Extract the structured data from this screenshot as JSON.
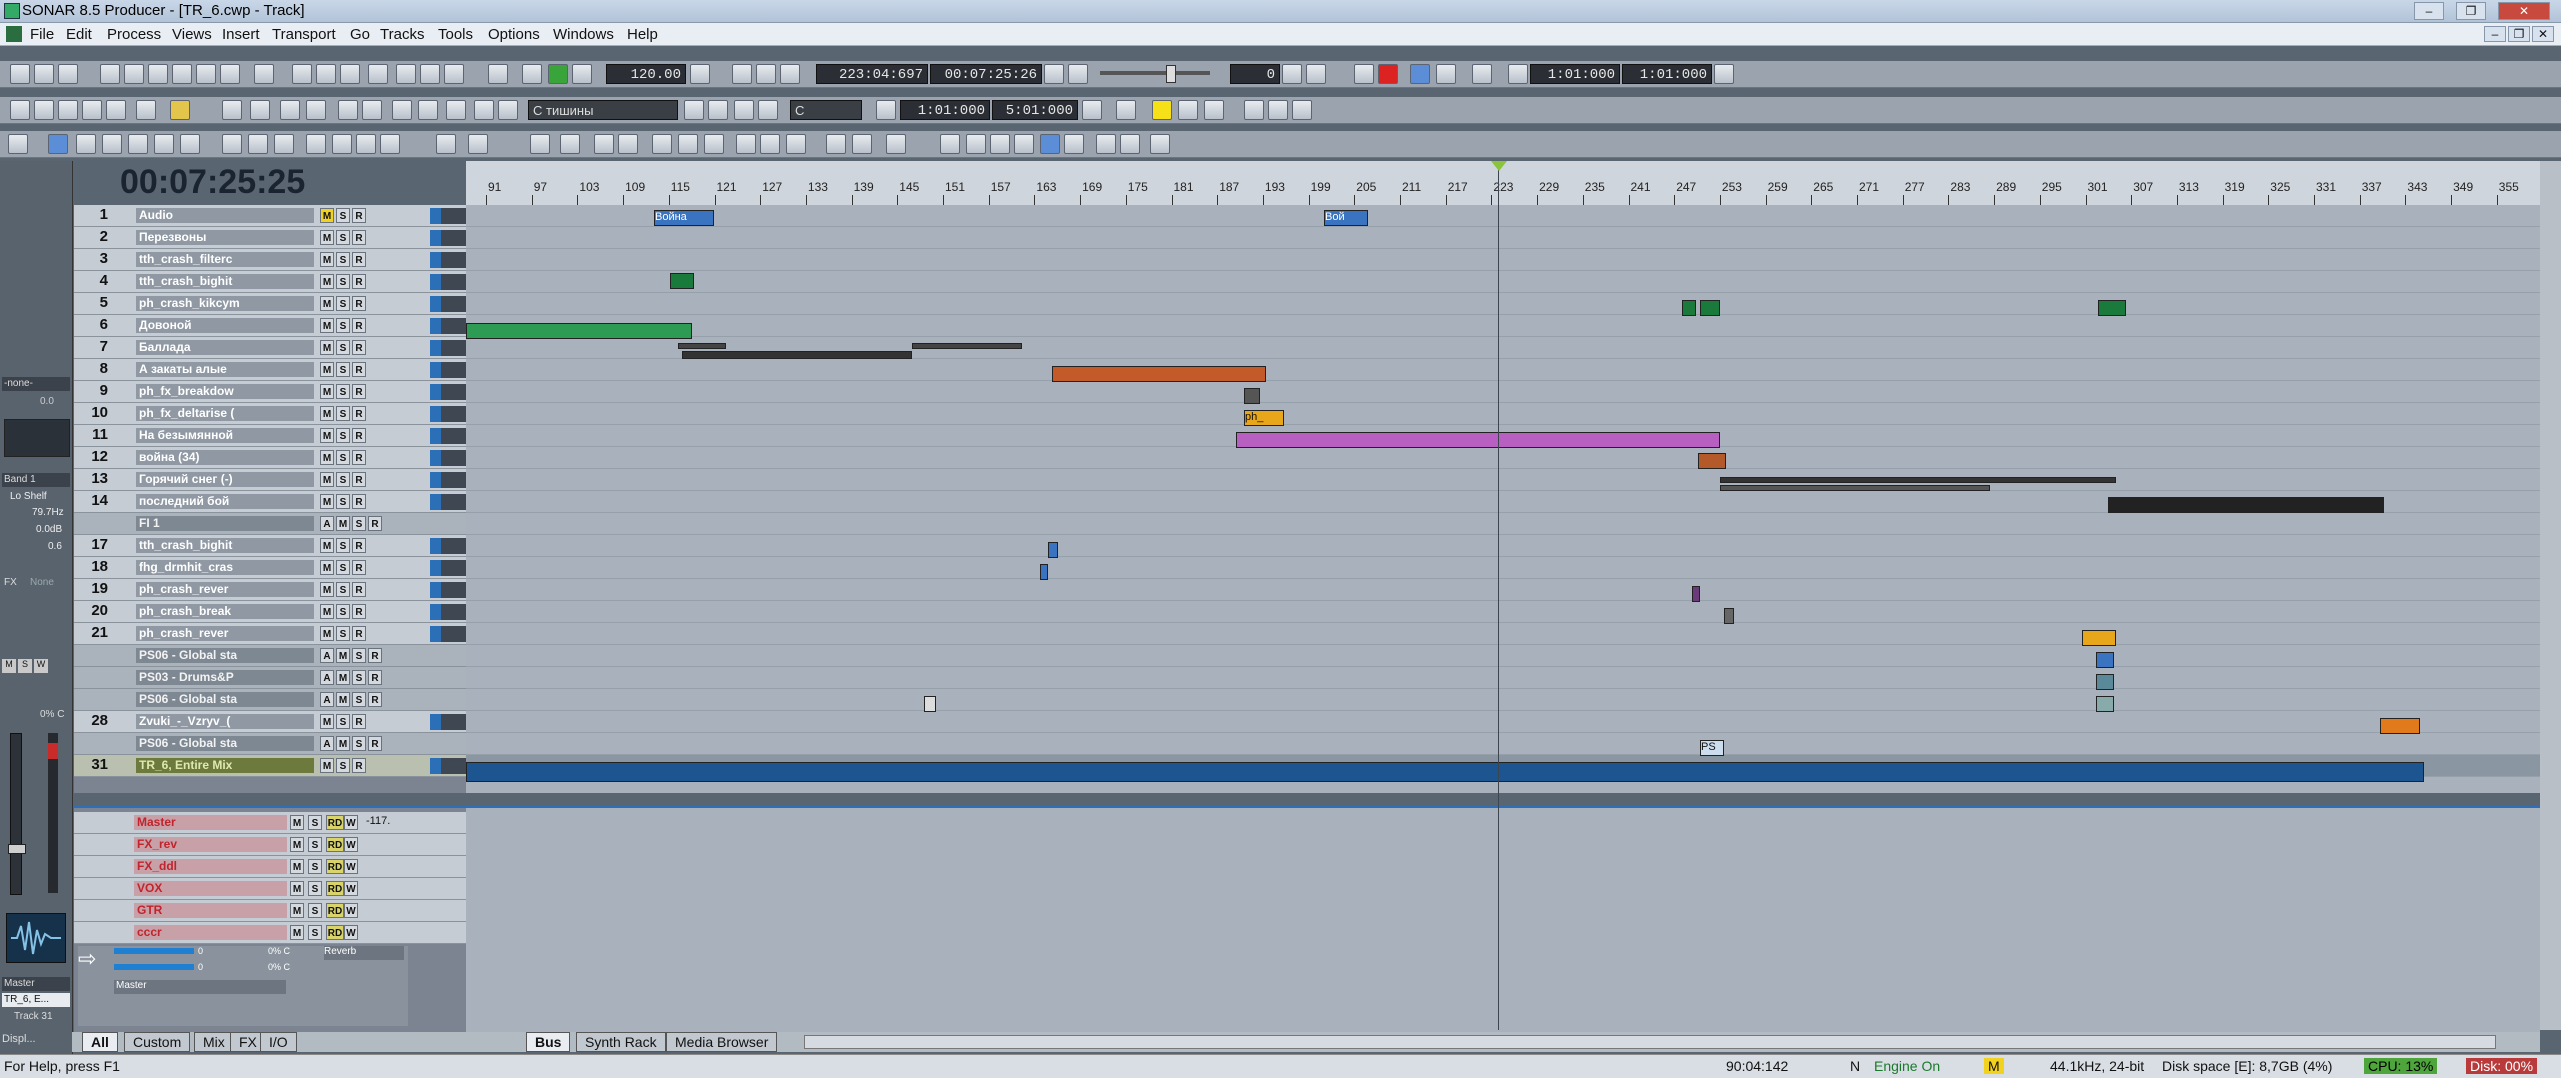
{
  "window": {
    "title": "SONAR 8.5 Producer - [TR_6.cwp - Track]",
    "min": "–",
    "max": "❐",
    "close": "✕"
  },
  "menu": [
    "File",
    "Edit",
    "Process",
    "Views",
    "Insert",
    "Transport",
    "Go",
    "Tracks",
    "Tools",
    "Options",
    "Windows",
    "Help"
  ],
  "transport": {
    "tempo": "120.00",
    "now_mbt": "223:04:697",
    "now_time": "00:07:25:26",
    "loop_start": "1:01:000",
    "loop_end": "1:01:000",
    "offset": "0"
  },
  "toolbar2": {
    "fade_preset": "С тишины",
    "key": "C",
    "sel_start": "1:01:000",
    "sel_end": "5:01:000"
  },
  "big_clock": "00:07:25:25",
  "ruler_ticks": [
    "91",
    "97",
    "103",
    "109",
    "115",
    "121",
    "127",
    "133",
    "139",
    "145",
    "151",
    "157",
    "163",
    "169",
    "175",
    "181",
    "187",
    "193",
    "199",
    "205",
    "211",
    "217",
    "223",
    "229",
    "235",
    "241",
    "247",
    "253",
    "259",
    "265",
    "271",
    "277",
    "283",
    "289",
    "295",
    "301",
    "307",
    "313",
    "319",
    "325",
    "331",
    "337",
    "343",
    "349",
    "355"
  ],
  "tracks": [
    {
      "num": "1",
      "name": "Audio",
      "folder": false,
      "m_on": true,
      "sel": false
    },
    {
      "num": "2",
      "name": "Перезвоны",
      "folder": false
    },
    {
      "num": "3",
      "name": "tth_crash_filterc",
      "folder": false
    },
    {
      "num": "4",
      "name": "tth_crash_bighit",
      "folder": false
    },
    {
      "num": "5",
      "name": "ph_crash_kikcym",
      "folder": false
    },
    {
      "num": "6",
      "name": "Довоной",
      "folder": false
    },
    {
      "num": "7",
      "name": "Баллада",
      "folder": false
    },
    {
      "num": "8",
      "name": "А закаты алые",
      "folder": false
    },
    {
      "num": "9",
      "name": "ph_fx_breakdow",
      "folder": false
    },
    {
      "num": "10",
      "name": "ph_fx_deltarise (",
      "folder": false
    },
    {
      "num": "11",
      "name": "На безымянной",
      "folder": false
    },
    {
      "num": "12",
      "name": "война (34)",
      "folder": false
    },
    {
      "num": "13",
      "name": "Горячий снег (-)",
      "folder": false
    },
    {
      "num": "14",
      "name": "последний бой",
      "folder": false
    },
    {
      "num": "",
      "name": "FI 1",
      "folder": true
    },
    {
      "num": "17",
      "name": "tth_crash_bighit",
      "folder": false
    },
    {
      "num": "18",
      "name": "fhg_drmhit_cras",
      "folder": false
    },
    {
      "num": "19",
      "name": "ph_crash_rever",
      "folder": false
    },
    {
      "num": "20",
      "name": "ph_crash_break",
      "folder": false
    },
    {
      "num": "21",
      "name": "ph_crash_rever",
      "folder": false
    },
    {
      "num": "",
      "name": "PS06 - Global sta",
      "folder": true
    },
    {
      "num": "",
      "name": "PS03 - Drums&P",
      "folder": true
    },
    {
      "num": "",
      "name": "PS06 - Global sta",
      "folder": true
    },
    {
      "num": "28",
      "name": "Zvuki_-_Vzryv_(",
      "folder": false
    },
    {
      "num": "",
      "name": "PS06 - Global sta",
      "folder": true
    },
    {
      "num": "31",
      "name": "TR_6, Entire Mix",
      "folder": false,
      "sel": true
    }
  ],
  "clip_labels": {
    "c1a": "Война",
    "c1b": "Вой",
    "c10": "ph_",
    "c24": "PS"
  },
  "buses": [
    {
      "name": "Master",
      "value": "-117."
    },
    {
      "name": "FX_rev"
    },
    {
      "name": "FX_ddl"
    },
    {
      "name": "VOX"
    },
    {
      "name": "GTR"
    },
    {
      "name": "cccr"
    }
  ],
  "bus_strip": {
    "send1": "0",
    "pan1": "0% C",
    "send2": "0",
    "pan2": "0% C",
    "fx": "Reverb",
    "out": "Master"
  },
  "tabs_left": [
    "All",
    "Custom",
    "Mix",
    "FX",
    "I/O"
  ],
  "tabs_right": [
    "Bus",
    "Synth Rack",
    "Media Browser"
  ],
  "left_strip": {
    "input": "-none-",
    "val1": "0.0",
    "band": "Band 1",
    "shape": "Lo Shelf",
    "freq": "79.7Hz",
    "gain": "0.0dB",
    "q": "0.6",
    "fx": "FX",
    "fx_none": "None",
    "pan": "0% C",
    "out": "Master",
    "track": "TR_6, E...",
    "track_num": "Track 31",
    "disp": "Displ..."
  },
  "status": {
    "help": "For Help, press F1",
    "time": "90:04:142",
    "engine_n": "N",
    "engine": "Engine On",
    "m": "M",
    "rate": "44.1kHz, 24-bit",
    "disk_space": "Disk space [E]: 8,7GB (4%)",
    "cpu": "CPU: 13%",
    "disk": "Disk: 00%"
  },
  "colors": {
    "accent": "#2d6fb8",
    "mute_on": "#f1d21e",
    "selected": "#6c7a3e"
  }
}
